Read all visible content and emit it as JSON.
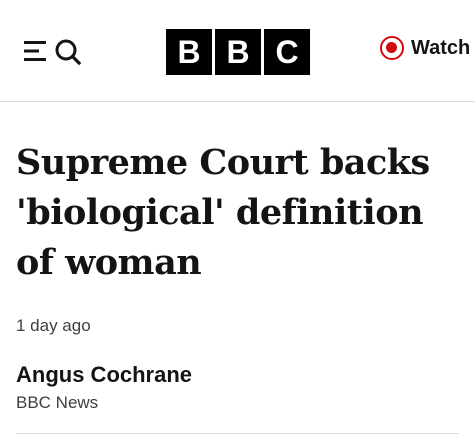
{
  "header": {
    "menu_icon": "menu-icon",
    "search_icon": "search-icon",
    "logo_letters": [
      "B",
      "B",
      "C"
    ],
    "watch_label": "Watch",
    "watch_icon": "live-dot-icon",
    "accent_color": "#d10a11"
  },
  "article": {
    "headline": "Supreme Court backs 'biological' definition of woman",
    "timestamp": "1 day ago",
    "author_name": "Angus Cochrane",
    "author_org": "BBC News"
  }
}
